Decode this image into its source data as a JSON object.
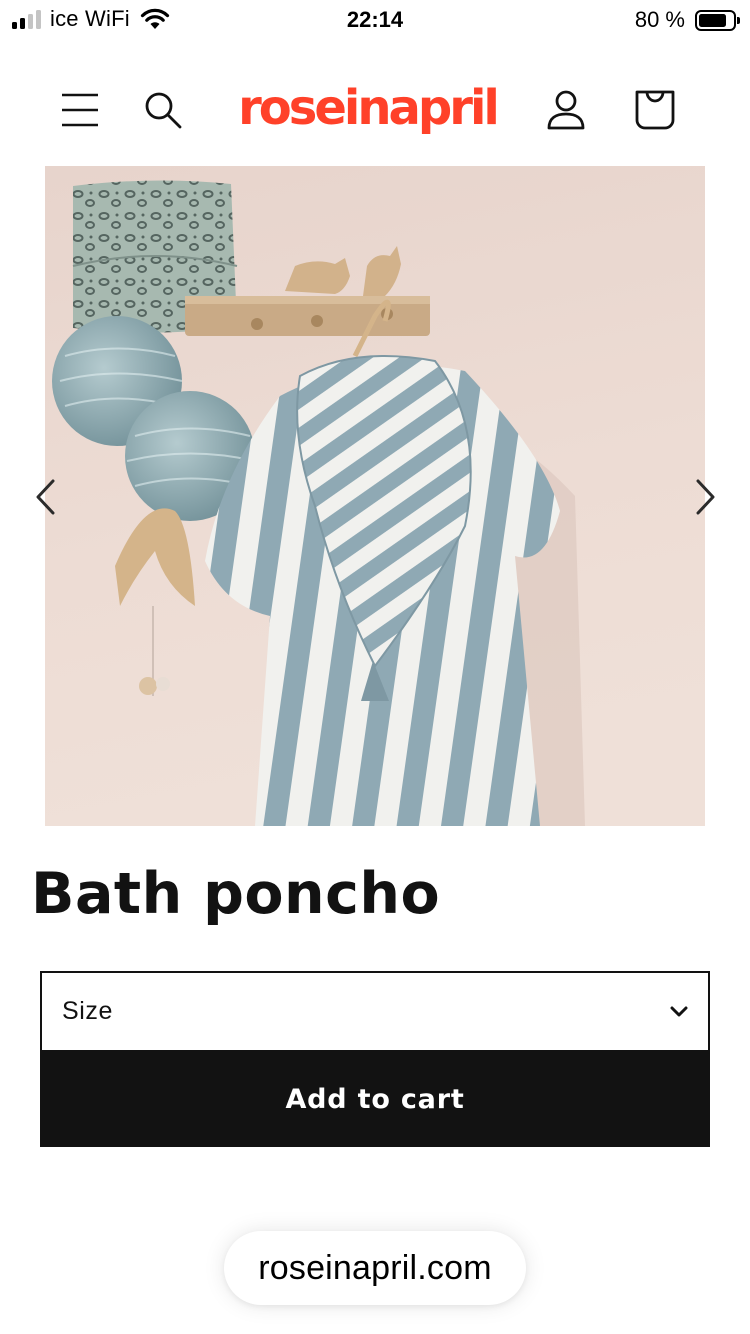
{
  "status_bar": {
    "carrier": "ice WiFi",
    "time": "22:14",
    "battery": "80 %",
    "battery_level": 0.8
  },
  "header": {
    "logo_text": "roseinapril",
    "logo_color": "#ff4129",
    "icons": [
      "menu-icon",
      "search-icon",
      "account-icon",
      "cart-icon"
    ]
  },
  "gallery": {
    "prev_icon": "chevron-left-icon",
    "next_icon": "chevron-right-icon"
  },
  "product": {
    "title": "Bath poncho",
    "size_label": "Size",
    "add_to_cart": "Add to cart"
  },
  "browser": {
    "url": "roseinapril.com"
  },
  "colors": {
    "accent": "#ff4129",
    "text": "#121212",
    "button_bg": "#121212",
    "button_text": "#ffffff"
  }
}
